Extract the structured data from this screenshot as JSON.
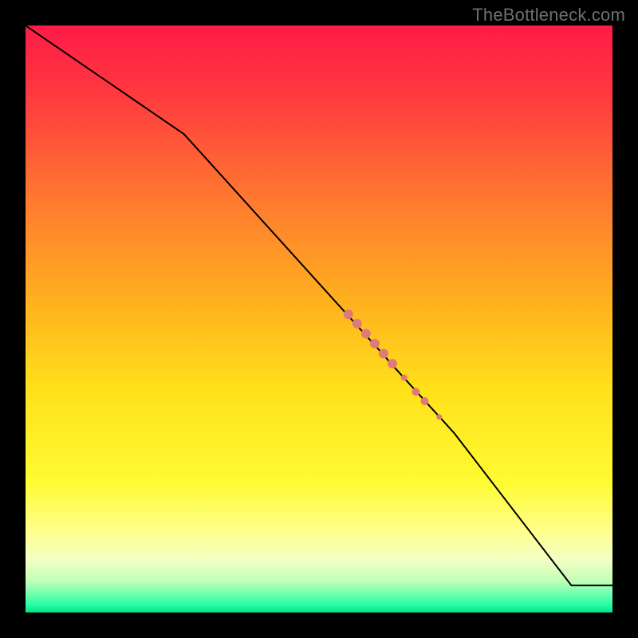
{
  "watermark": {
    "text": "TheBottleneck.com"
  },
  "chart_data": {
    "type": "line",
    "title": "",
    "xlabel": "",
    "ylabel": "",
    "xlim": [
      0,
      100
    ],
    "ylim": [
      0,
      100
    ],
    "grid": false,
    "legend": false,
    "gradient_stops": [
      {
        "offset": 0.0,
        "color": "#ff1b47"
      },
      {
        "offset": 0.12,
        "color": "#ff3a3f"
      },
      {
        "offset": 0.3,
        "color": "#ff7a2f"
      },
      {
        "offset": 0.48,
        "color": "#ffb41e"
      },
      {
        "offset": 0.62,
        "color": "#ffe11a"
      },
      {
        "offset": 0.78,
        "color": "#fffb33"
      },
      {
        "offset": 0.86,
        "color": "#ffff8a"
      },
      {
        "offset": 0.91,
        "color": "#f3ffc4"
      },
      {
        "offset": 0.945,
        "color": "#c4ffb8"
      },
      {
        "offset": 0.965,
        "color": "#7dffb0"
      },
      {
        "offset": 0.985,
        "color": "#2effa6"
      },
      {
        "offset": 1.0,
        "color": "#00e58a"
      }
    ],
    "series": [
      {
        "name": "main-curve",
        "color": "#000000",
        "stroke_width": 2,
        "x": [
          0.0,
          27.0,
          60.0,
          63.0,
          67.0,
          69.0,
          71.0,
          73.0,
          93.0,
          100.0
        ],
        "y": [
          100.0,
          81.5,
          45.0,
          41.6,
          37.2,
          35.0,
          32.8,
          30.6,
          4.6,
          4.6
        ]
      },
      {
        "name": "highlight-markers",
        "color": "#e07a78",
        "type": "scatter",
        "points": [
          {
            "x": 55.0,
            "y": 50.8,
            "r": 6
          },
          {
            "x": 56.5,
            "y": 49.2,
            "r": 6
          },
          {
            "x": 58.0,
            "y": 47.5,
            "r": 6
          },
          {
            "x": 59.5,
            "y": 45.8,
            "r": 6
          },
          {
            "x": 61.0,
            "y": 44.1,
            "r": 6
          },
          {
            "x": 62.5,
            "y": 42.4,
            "r": 6
          },
          {
            "x": 64.5,
            "y": 40.0,
            "r": 4
          },
          {
            "x": 66.5,
            "y": 37.6,
            "r": 5
          },
          {
            "x": 68.0,
            "y": 36.0,
            "r": 5
          },
          {
            "x": 70.5,
            "y": 33.3,
            "r": 3.5
          }
        ]
      }
    ]
  }
}
